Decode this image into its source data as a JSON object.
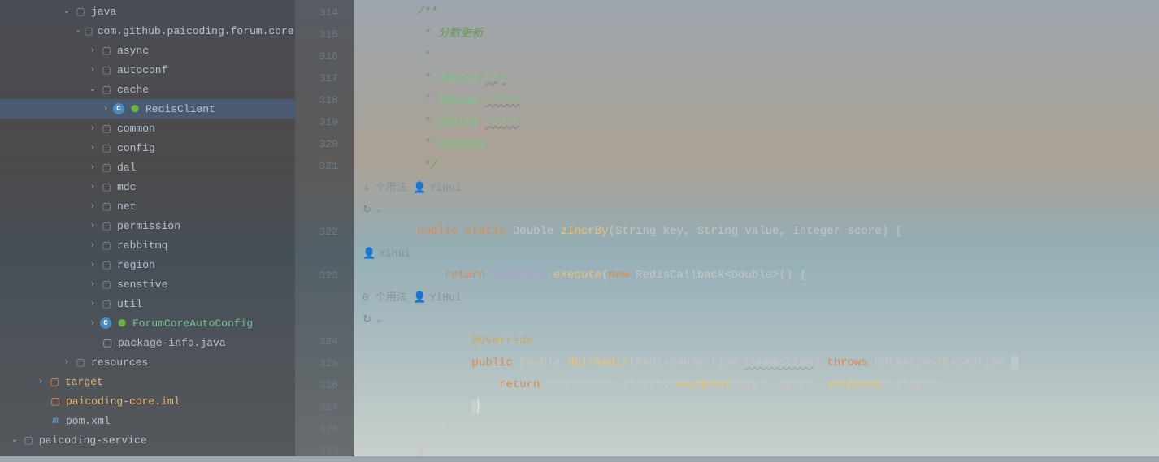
{
  "tree": {
    "java": "java",
    "package": "com.github.paicoding.forum.core",
    "items": [
      {
        "label": "async",
        "icon": "folder"
      },
      {
        "label": "autoconf",
        "icon": "folder"
      },
      {
        "label": "cache",
        "icon": "folder",
        "expanded": true
      },
      {
        "label": "RedisClient",
        "icon": "class",
        "selected": true,
        "spring": true
      },
      {
        "label": "common",
        "icon": "folder"
      },
      {
        "label": "config",
        "icon": "folder"
      },
      {
        "label": "dal",
        "icon": "folder"
      },
      {
        "label": "mdc",
        "icon": "folder"
      },
      {
        "label": "net",
        "icon": "folder"
      },
      {
        "label": "permission",
        "icon": "folder"
      },
      {
        "label": "rabbitmq",
        "icon": "folder"
      },
      {
        "label": "region",
        "icon": "folder"
      },
      {
        "label": "senstive",
        "icon": "folder"
      },
      {
        "label": "util",
        "icon": "folder"
      },
      {
        "label": "ForumCoreAutoConfig",
        "icon": "class",
        "spring": true,
        "highlighted": true
      },
      {
        "label": "package-info.java",
        "icon": "java"
      }
    ],
    "resources": "resources",
    "target": "target",
    "iml": "paicoding-core.iml",
    "pom": "pom.xml",
    "service_module": "paicoding-service"
  },
  "gutter": {
    "lines": [
      "314",
      "315",
      "316",
      "317",
      "318",
      "319",
      "320",
      "321",
      "",
      "322",
      "",
      "323",
      "",
      "",
      "324",
      "325",
      "326",
      "327",
      "328",
      "329"
    ],
    "vcs_marker_line": "325"
  },
  "hints": {
    "usage4": "4 个用法",
    "usage0": "0 个用法",
    "author": "YiHui"
  },
  "code": {
    "l314": "/**",
    "l315_prefix": " * ",
    "l315_text": "分数更新",
    "l316": " *",
    "l317_prefix": " * ",
    "l317_tag": "@param",
    "l317_param": "key",
    "l318_prefix": " * ",
    "l318_tag": "@param",
    "l318_param": "value",
    "l319_prefix": " * ",
    "l319_tag": "@param",
    "l319_param": "score",
    "l320_prefix": " * ",
    "l320_tag": "@return",
    "l321": " */",
    "l322_public": "public",
    "l322_static": "static",
    "l322_type": "Double",
    "l322_method": "zIncrBy",
    "l322_params": "(String key, String value, Integer score)",
    "l322_brace": " {",
    "l323_return": "return",
    "l323_field": "template",
    "l323_dot": ".",
    "l323_exec": "execute",
    "l323_new": "new",
    "l323_callback": "RedisCallback",
    "l323_generic": "<Double>() {",
    "l324_annotation": "@Override",
    "l325_public": "public",
    "l325_type": "Double",
    "l325_method": "doInRedis",
    "l325_paren_open": "(",
    "l325_ptype": "RedisConnection",
    "l325_pname": "connection",
    "l325_paren_close": ")",
    "l325_throws": "throws",
    "l325_exc": "DataAccessException",
    "l325_brace": "{",
    "l326_return": "return",
    "l326_conn": "connection",
    "l326_zincr": ".zIncrBy(",
    "l326_keybytes": "keyBytes",
    "l326_key": "key",
    "l326_score": "score",
    "l326_valbytes": "valBytes",
    "l326_value": "value",
    "l326_end": "));",
    "l327": "}",
    "l328": "});",
    "l329": "}"
  }
}
